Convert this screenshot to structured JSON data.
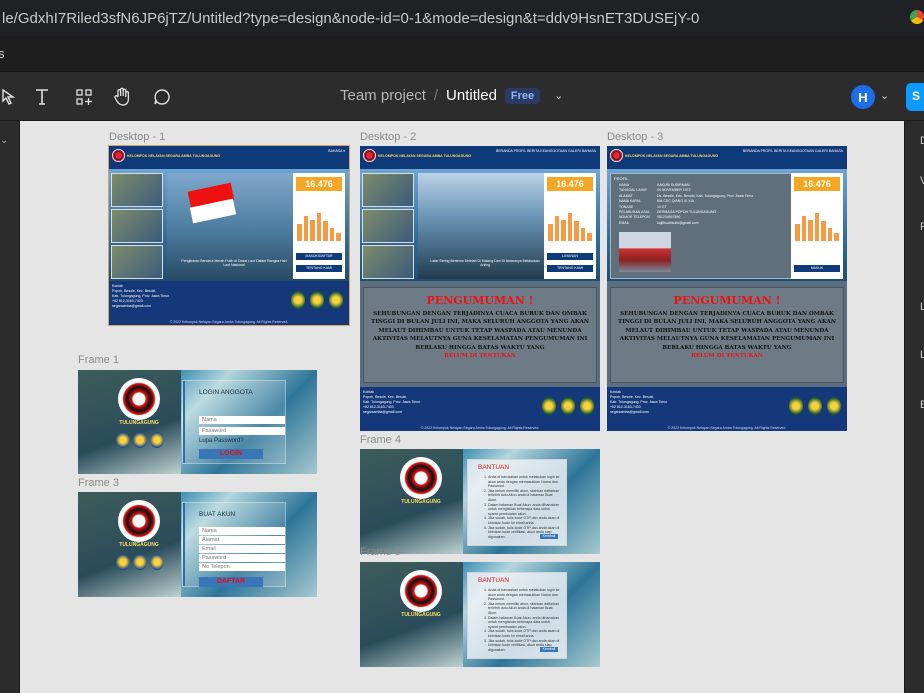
{
  "browser": {
    "url": "le/GdxhI7Riled3sfN6JP6jTZ/Untitled?type=design&node-id=0-1&mode=design&t=ddv9HsnET3DUSEjY-0"
  },
  "menu": {
    "label": "s"
  },
  "toolbar": {
    "project": "Team project",
    "separator": "/",
    "file": "Untitled",
    "plan_badge": "Free",
    "user_initial": "H",
    "share_label": "S"
  },
  "frames": {
    "d1": "Desktop - 1",
    "d2": "Desktop - 2",
    "d3": "Desktop - 3",
    "f1": "Frame 1",
    "f3": "Frame 3",
    "f4": "Frame 4",
    "f5": "Frame 5"
  },
  "site": {
    "title": "KELOMPOK NELAYAN SEGARA AMBA TULUNGAGUNG",
    "nav": "BERANDA   PROFIL   BERITA   KEANGGOTAAN   GALERI   BAHASA",
    "counter": "16.476",
    "caption1": "Pengibaran Bendera Merah Putih di Dasar Laut Dalam Rangka Hari Laut Nasional",
    "caption2": "Latar Sering Bertemu Setelah Di Malang Dan Di Antaranya Melakukan Aniing",
    "btn_layanan": "LAYANAN",
    "btn_masuk": "MASUK",
    "btn_tentang": "TENTANG KAMI",
    "btn_masuk_daftar": "MASUK/DAFTAR",
    "footer_info": "Kontak\nPopoh, Besole, Kec. Besuki,\nKab. Tulungagung, Prov. Jawa Timur\n+62 812-3163-7403\nsegaraamba@gmail.com",
    "copyright": "© 2022 Kelompok Nelayan Segara Amba Tulungagung. All Rights Reserved.",
    "announce_title": "PENGUMUMAN !",
    "announce_body": "SEHUBUNGAN DENGAN TERJADINYA CUACA BURUK DAN OMBAK TINGGI DI BULAN JULI INI, MAKA SELURUH ANGGOTA YANG AKAN MELAUT DIHIMBAU UNTUK TETAP WASPADA ATAU MENUNDA AKTIVITAS MELAUTNYA GUNA KESELAMATAN PENGUMUMAN INI BERLAKU HINGGA BATAS WAKTU YANG",
    "announce_end": "BELUM DI TENTUKAN"
  },
  "profile": {
    "heading": "PROFIL",
    "rows": [
      [
        "NAMA",
        "KAKUBI SUDIRMAN"
      ],
      [
        "TANGGAL LAHIR",
        "04 NOVEMBER 1972"
      ],
      [
        "ALAMAT",
        "Ds. Besole, Kec. Besuki, Kab. Tulungagung, Prov. Jawa Timur"
      ],
      [
        "NAMA KAPAL",
        "KM CDC QIANG XI XIA"
      ],
      [
        "TONASE",
        "10 GT"
      ],
      [
        "PELABUHAN ASAL",
        "DERMAGA POPOH TULUNGAGUNG"
      ],
      [
        "NOMOR TELEPON",
        "081234567890"
      ],
      [
        "EMAIL",
        "kajifhsutrisulin@gmail.com"
      ]
    ]
  },
  "login": {
    "logo_text": "TULUNGAGUNG",
    "title": "LOGIN ANGGOTA",
    "name": "Nama",
    "password": "Password",
    "forgot": "Lupa Password?",
    "action": "LOGIN"
  },
  "register": {
    "title": "BUAT AKUN",
    "name": "Nama",
    "address": "Alamat",
    "email": "Email",
    "password": "Password",
    "phone": "No Telepon",
    "action": "DAFTAR"
  },
  "help": {
    "title": "BANTUAN",
    "items": [
      "Anda di harusakan untuk melakukan login ke akun anda dengan memasukkan Nama dan Password.",
      "Jika belum memiliki akun, silahkan daftarkan terlebih dulu Akun anda di halaman Buat Akun.",
      "Dalam halaman Buat Akun, anda diharuskan untuk mengisikan beberapa data untuk syarat pembuatan akun.",
      "Jika sudah, tulis kode OTP dan anda akan di kirimkan kode ke email anda.",
      "Jika sudah, tulis kode OTP dan anda akan di kirimkan kode verifikasi, akun anda siap digunakan."
    ],
    "ok": "Kembali"
  },
  "right_panel": [
    "D",
    "V",
    "F",
    "L",
    "L",
    "E"
  ]
}
